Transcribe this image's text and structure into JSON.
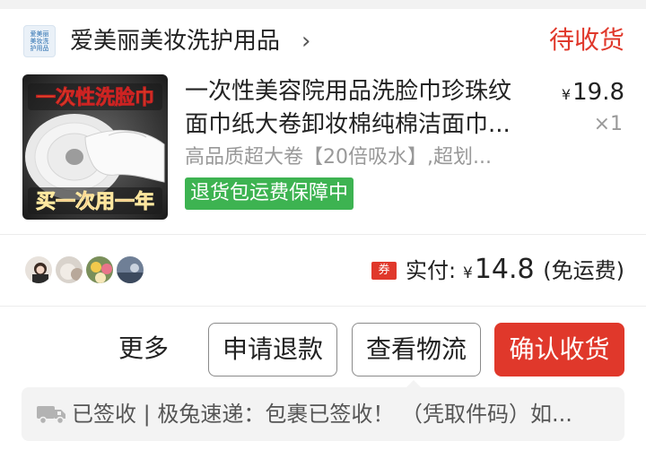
{
  "shop": {
    "logo_lines": [
      "爱美丽",
      "美妆洗",
      "护用品"
    ],
    "name": "爱美丽美妆洗护用品",
    "chevron_icon": "chevron-right-icon",
    "order_status": "待收货",
    "status_color": "#e0382b"
  },
  "product": {
    "image_caption_top": "一次性洗脸巾",
    "image_caption_bottom": "买一次用一年",
    "title_line1": "一次性美容院用品洗脸巾珍珠纹",
    "title_line2": "面巾纸大卷卸妆棉纯棉洁面巾...",
    "price_symbol": "¥",
    "price": "19.8",
    "quantity": "×1",
    "sku": "高品质超大卷【20倍吸水】,超划...",
    "guarantee": "退货包运费保障中",
    "guarantee_color": "#3db351"
  },
  "summary": {
    "coupon_badge": "券",
    "paid_label": "实付:",
    "currency": "¥",
    "paid_amount": "14.8",
    "shipping_note": "(免运费)"
  },
  "actions": {
    "more_label": "更多",
    "refund_label": "申请退款",
    "logistics_label": "查看物流",
    "confirm_label": "确认收货",
    "confirm_color": "#e0382b"
  },
  "logistics": {
    "icon": "truck-icon",
    "text": "已签收 | 极兔速递：包裹已签收！ （凭取件码）如..."
  }
}
